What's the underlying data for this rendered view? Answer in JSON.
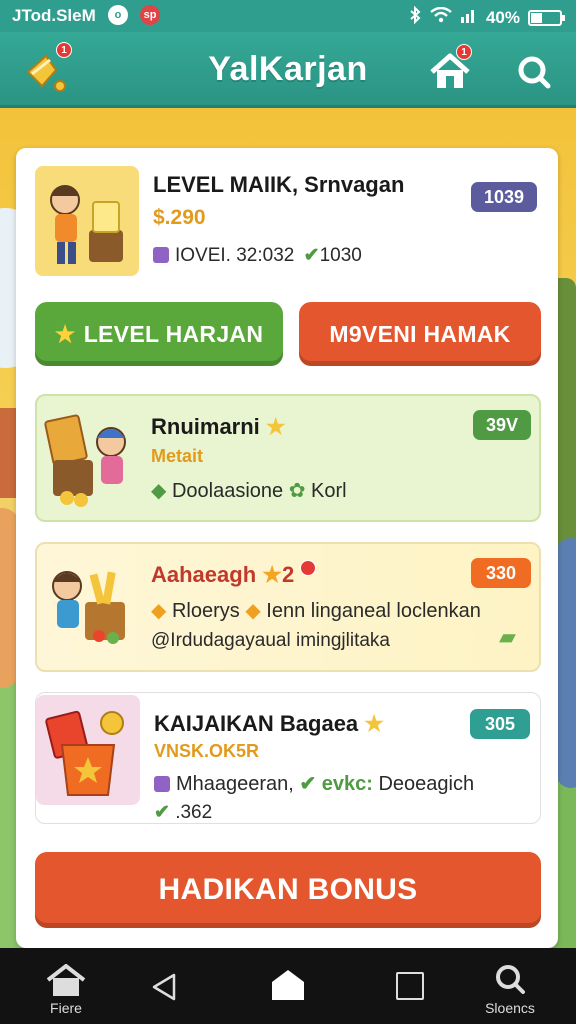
{
  "status_bar": {
    "carrier": "JTod.SleM",
    "dot1": "o",
    "dot2": "sp",
    "battery": "40%",
    "battery_level": 0.4
  },
  "header": {
    "title": "YalKarjan",
    "bell_badge": "1",
    "home_badge": "1"
  },
  "top_card": {
    "title": "LEVEL MAIIK, Srnvagan",
    "amount": "$.290",
    "meta1": "IOVEI. 32:032",
    "meta2": "1030",
    "pill": "1039"
  },
  "buttons": {
    "left": "LEVEL HARJAN",
    "right": "M9VENI HAMAK",
    "bonus": "HADIKAN BONUS"
  },
  "cards": [
    {
      "title": "Rnuimarni",
      "subtitle": "Metait",
      "line1_a": "Doolaasione",
      "line1_b": "Korl",
      "pill": "39V"
    },
    {
      "title": "Aahaeagh",
      "title_suffix": "2",
      "line1_a": "Rloerys",
      "line1_b": "Ienn linganeal loclenkan",
      "line2": "@Irdudagayaual imingjlitaka",
      "pill": "330"
    },
    {
      "title": "KAIJAIKAN  Bagaea",
      "subtitle": "VNSK.OK5R",
      "line1_a": "Mhaageeran,",
      "line1_b": "evkc:",
      "line1_c": "Deoeagich",
      "line2": ".362",
      "pill": "305"
    }
  ],
  "nav": {
    "home_label": "Fiere",
    "search_label": "Sloencs"
  },
  "colors": {
    "teal": "#2f9e8f",
    "green": "#5aa83c",
    "orange": "#e4572e",
    "pill_purple": "#5b5b9e",
    "pill_green": "#4f9a43",
    "pill_orange": "#ef6c22",
    "pill_teal": "#2f9f93"
  }
}
